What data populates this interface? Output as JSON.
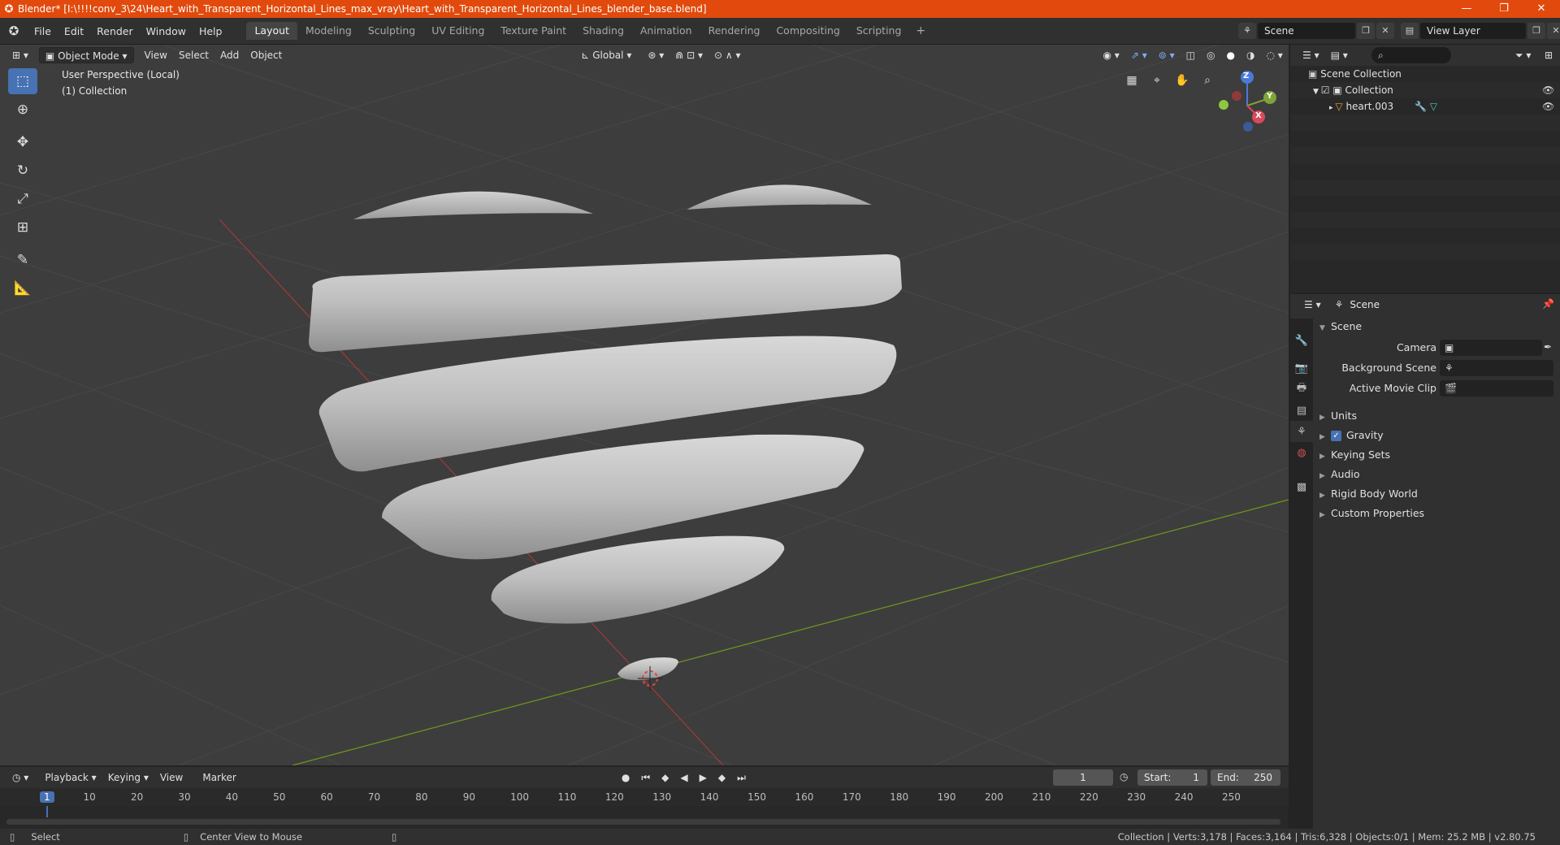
{
  "titlebar": {
    "title": "Blender* [I:\\!!!!conv_3\\24\\Heart_with_Transparent_Horizontal_Lines_max_vray\\Heart_with_Transparent_Horizontal_Lines_blender_base.blend]",
    "minimize": "—",
    "maximize": "❐",
    "close": "✕"
  },
  "menu": {
    "file": "File",
    "edit": "Edit",
    "render": "Render",
    "window": "Window",
    "help": "Help"
  },
  "workspaces": [
    "Layout",
    "Modeling",
    "Sculpting",
    "UV Editing",
    "Texture Paint",
    "Shading",
    "Animation",
    "Rendering",
    "Compositing",
    "Scripting"
  ],
  "scene_selector": "Scene",
  "view_layer": "View Layer",
  "viewport": {
    "mode": "Object Mode",
    "view": "View",
    "select": "Select",
    "add": "Add",
    "object": "Object",
    "transform": "Global",
    "overlay_line1": "User Perspective (Local)",
    "overlay_line2": "(1) Collection",
    "gizmo": {
      "z": "Z",
      "y": "Y",
      "x": "X"
    }
  },
  "outliner": {
    "scene_collection": "Scene Collection",
    "collection": "Collection",
    "object": "heart.003"
  },
  "properties": {
    "header": "Scene",
    "panel_title": "Scene",
    "camera_label": "Camera",
    "background_scene_label": "Background Scene",
    "active_movie_clip_label": "Active Movie Clip",
    "sections": [
      "Units",
      "Gravity",
      "Keying Sets",
      "Audio",
      "Rigid Body World",
      "Custom Properties"
    ]
  },
  "timeline": {
    "playback": "Playback",
    "keying": "Keying",
    "view": "View",
    "marker": "Marker",
    "current_frame": "1",
    "start_label": "Start:",
    "start": "1",
    "end_label": "End:",
    "end": "250",
    "ticks": [
      "1",
      "10",
      "20",
      "30",
      "40",
      "50",
      "60",
      "70",
      "80",
      "90",
      "100",
      "110",
      "120",
      "130",
      "140",
      "150",
      "160",
      "170",
      "180",
      "190",
      "200",
      "210",
      "220",
      "230",
      "240",
      "250"
    ]
  },
  "statusbar": {
    "select": "Select",
    "center_view": "Center View to Mouse",
    "stats": "Collection | Verts:3,178 | Faces:3,164 | Tris:6,328 | Objects:0/1 | Mem: 25.2 MB | v2.80.75"
  },
  "colors": {
    "accent": "#4772b3",
    "titlebar": "#e14a0c",
    "x_axis": "#a33a3a",
    "y_axis": "#6e9a1e"
  }
}
